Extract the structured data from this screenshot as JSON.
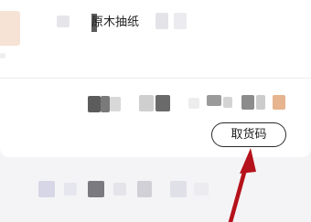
{
  "order_card": {
    "product_title": "原木抽纸",
    "pickup_button_label": "取货码"
  },
  "colors": {
    "annotation_arrow": "#b5121b",
    "button_border": "#2a2a2a"
  }
}
